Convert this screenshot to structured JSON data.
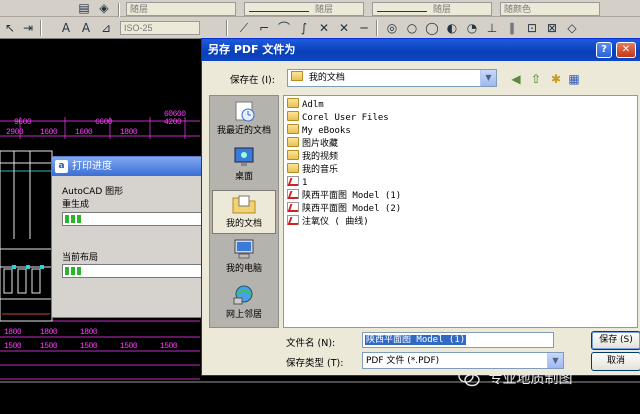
{
  "toolbar_top": {
    "layer_combo_1": "随层",
    "layer_combo_2": "随层",
    "layer_combo_3": "随层",
    "color_combo": "随颜色"
  },
  "toolbar_second": {
    "text_style_combo": "ISO-25"
  },
  "cad": {
    "dimensions": [
      "60600",
      "9600",
      "6600",
      "4200",
      "2900",
      "1600",
      "1600",
      "1800",
      "1800",
      "1800",
      "1800",
      "1500",
      "1500",
      "1500",
      "1500",
      "1500"
    ]
  },
  "print_progress": {
    "title": "打印进度",
    "app_icon_text": "a",
    "line1": "AutoCAD 图形",
    "line2": "重生成",
    "bar1_progress": 0.12,
    "label2": "当前布局",
    "bar2_progress": 0.12
  },
  "save_dialog": {
    "title": "另存 PDF 文件为",
    "help_icon": "?",
    "close_icon": "✕",
    "save_in_label": "保存在 (I):",
    "save_in_value": "我的文档",
    "places": [
      {
        "label": "我最近的文档",
        "icon": "recent-documents-icon"
      },
      {
        "label": "桌面",
        "icon": "desktop-icon"
      },
      {
        "label": "我的文档",
        "icon": "my-documents-icon"
      },
      {
        "label": "我的电脑",
        "icon": "my-computer-icon"
      },
      {
        "label": "网上邻居",
        "icon": "network-places-icon"
      }
    ],
    "files": [
      {
        "name": "Adlm",
        "type": "folder"
      },
      {
        "name": "Corel User Files",
        "type": "folder"
      },
      {
        "name": "My eBooks",
        "type": "folder"
      },
      {
        "name": "图片收藏",
        "type": "folder"
      },
      {
        "name": "我的视频",
        "type": "folder"
      },
      {
        "name": "我的音乐",
        "type": "folder"
      },
      {
        "name": "1",
        "type": "pdf"
      },
      {
        "name": "陕西平面图 Model (1)",
        "type": "pdf"
      },
      {
        "name": "陕西平面图 Model (2)",
        "type": "pdf"
      },
      {
        "name": "注氧仪 ( 曲线)",
        "type": "pdf"
      }
    ],
    "filename_label": "文件名 (N):",
    "filename_value": "陕西平面图 Model (1)",
    "filetype_label": "保存类型 (T):",
    "filetype_value": "PDF 文件 (*.PDF)",
    "save_button": "保存 (S)",
    "cancel_button": "取消"
  },
  "watermark": {
    "text": "专业地质制图"
  }
}
